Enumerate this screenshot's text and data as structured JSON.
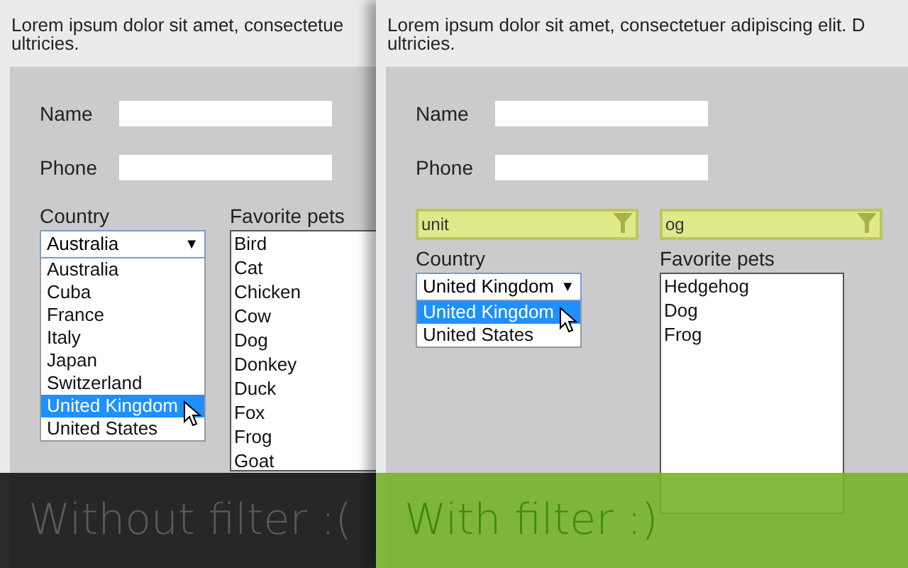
{
  "panels": [
    {
      "paragraph": [
        "Lorem ipsum dolor sit amet, consectetue",
        "ultricies."
      ],
      "fields": [
        {
          "label": "Name"
        },
        {
          "label": "Phone"
        }
      ],
      "country": {
        "label": "Country",
        "value": "Australia",
        "caret": "▼",
        "options": [
          {
            "text": "Australia",
            "highlighted": false
          },
          {
            "text": "Cuba",
            "highlighted": false
          },
          {
            "text": "France",
            "highlighted": false
          },
          {
            "text": "Italy",
            "highlighted": false
          },
          {
            "text": "Japan",
            "highlighted": false
          },
          {
            "text": "Switzerland",
            "highlighted": false
          },
          {
            "text": "United Kingdom",
            "highlighted": true
          },
          {
            "text": "United States",
            "highlighted": false
          }
        ]
      },
      "pets": {
        "label": "Favorite pets",
        "items": [
          "Bird",
          "Cat",
          "Chicken",
          "Cow",
          "Dog",
          "Donkey",
          "Duck",
          "Fox",
          "Frog",
          "Goat"
        ]
      },
      "caption": {
        "kind": "bad",
        "text": "Without filter :("
      }
    },
    {
      "paragraph": [
        "Lorem ipsum dolor sit amet, consectetuer adipiscing elit. D",
        "ultricies."
      ],
      "fields": [
        {
          "label": "Name"
        },
        {
          "label": "Phone"
        }
      ],
      "filters": {
        "country": "unit",
        "pets": "og"
      },
      "country": {
        "label": "Country",
        "value": "United Kingdom",
        "caret": "▼",
        "options": [
          {
            "text": "United Kingdom",
            "highlighted": true
          },
          {
            "text": "United States",
            "highlighted": false
          }
        ]
      },
      "pets": {
        "label": "Favorite pets",
        "items": [
          "Hedgehog",
          "Dog",
          "Frog"
        ]
      },
      "caption": {
        "kind": "good",
        "text": "With filter :)"
      }
    }
  ]
}
